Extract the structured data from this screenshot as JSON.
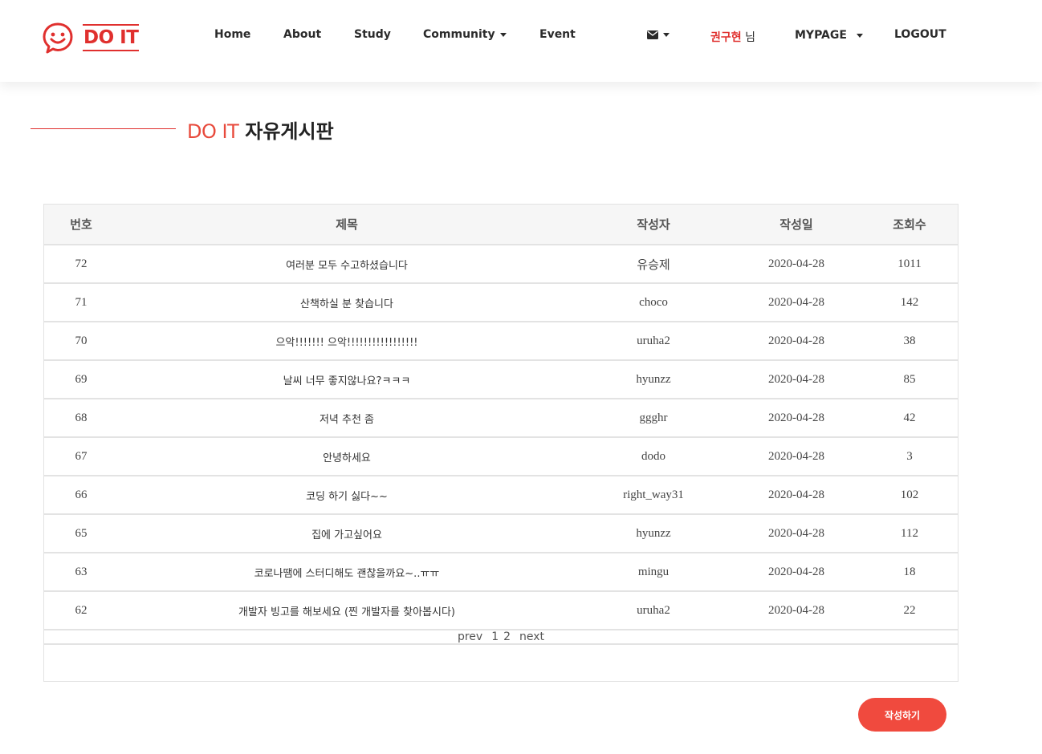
{
  "header": {
    "logo_text": "DO IT",
    "nav": [
      "Home",
      "About",
      "Study",
      "Community",
      "Event"
    ],
    "user_name": "권구현",
    "user_suffix": "님",
    "mypage": "MYPAGE",
    "logout": "LOGOUT"
  },
  "page": {
    "brand": "DO IT",
    "board_name": "자유게시판"
  },
  "table": {
    "headers": [
      "번호",
      "제목",
      "작성자",
      "작성일",
      "조회수"
    ],
    "rows": [
      {
        "no": "72",
        "subject": "여러분 모두 수고하셨습니다",
        "author": "유승제",
        "date": "2020-04-28",
        "views": "1011"
      },
      {
        "no": "71",
        "subject": "산책하실 분 찾습니다",
        "author": "choco",
        "date": "2020-04-28",
        "views": "142"
      },
      {
        "no": "70",
        "subject": "으악!!!!!!! 으악!!!!!!!!!!!!!!!!!",
        "author": "uruha2",
        "date": "2020-04-28",
        "views": "38"
      },
      {
        "no": "69",
        "subject": "날씨 너무 좋지않나요?ㅋㅋㅋ",
        "author": "hyunzz",
        "date": "2020-04-28",
        "views": "85"
      },
      {
        "no": "68",
        "subject": "저녁 추천 좀",
        "author": "ggghr",
        "date": "2020-04-28",
        "views": "42"
      },
      {
        "no": "67",
        "subject": "안녕하세요",
        "author": "dodo",
        "date": "2020-04-28",
        "views": "3"
      },
      {
        "no": "66",
        "subject": "코딩 하기 싫다~~",
        "author": "right_way31",
        "date": "2020-04-28",
        "views": "102"
      },
      {
        "no": "65",
        "subject": "집에 가고싶어요",
        "author": "hyunzz",
        "date": "2020-04-28",
        "views": "112"
      },
      {
        "no": "63",
        "subject": "코로나땜에 스터디해도 괜찮을까요~..ㅠㅠ",
        "author": "mingu",
        "date": "2020-04-28",
        "views": "18"
      },
      {
        "no": "62",
        "subject": "개발자 빙고를 해보세요 (찐 개발자를 찾아봅시다)",
        "author": "uruha2",
        "date": "2020-04-28",
        "views": "22"
      }
    ]
  },
  "pagination": {
    "prev": "prev",
    "pages": [
      "1",
      "2"
    ],
    "next": "next"
  },
  "write_button": "작성하기",
  "colors": {
    "accent": "#e0302e",
    "button": "#f04a3e"
  },
  "icons": {
    "logo": "smiley-chat-icon",
    "mail": "envelope-icon"
  }
}
